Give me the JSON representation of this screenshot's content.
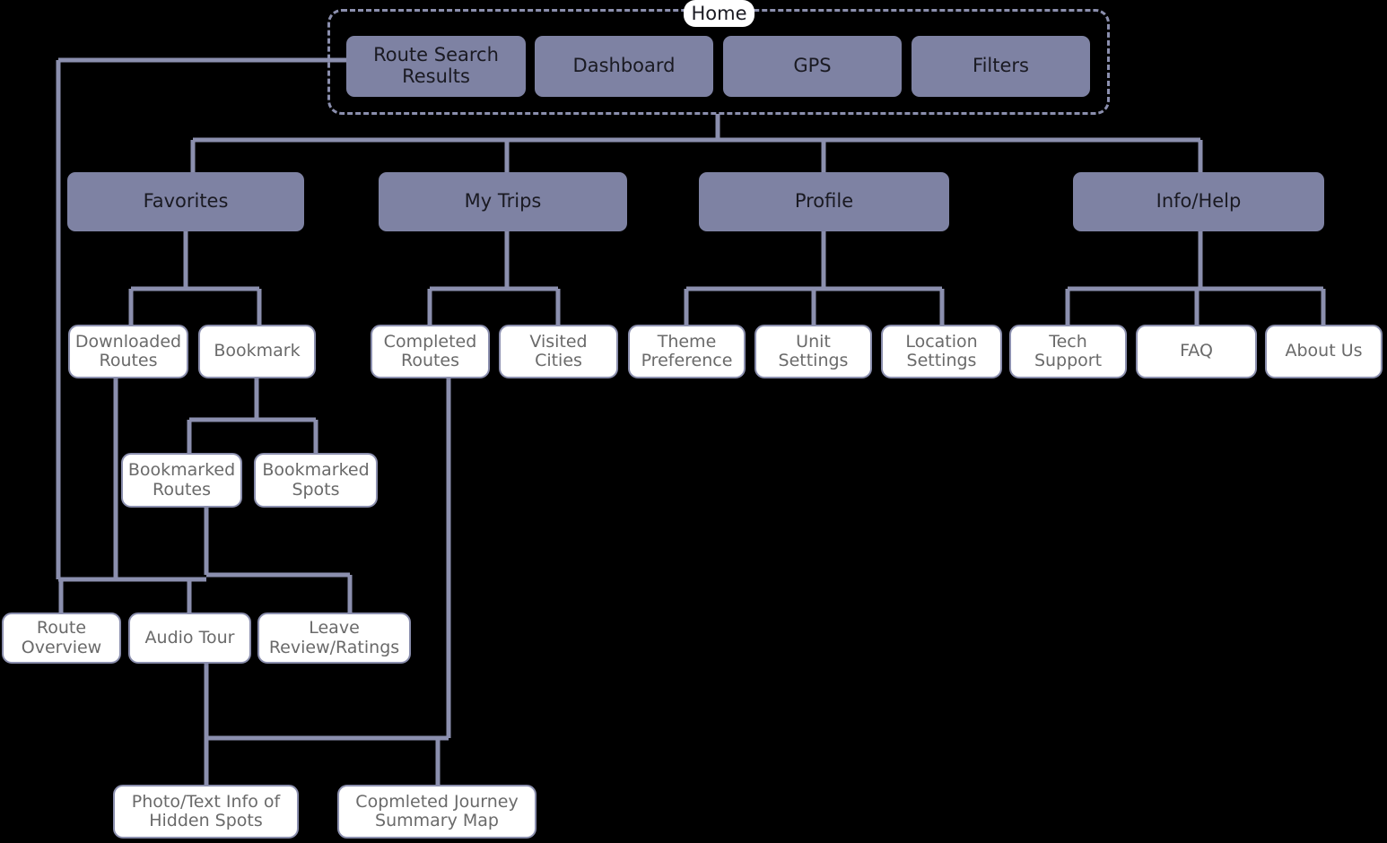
{
  "diagram": {
    "title": "Home",
    "type": "sitemap",
    "colors": {
      "background": "#000000",
      "branch_fill": "#7e82a3",
      "leaf_fill": "#ffffff",
      "stroke": "#8b8fae",
      "branch_text": "#1a1a22",
      "leaf_text": "#6a6a6a"
    }
  },
  "group": {
    "label": "Home",
    "items": [
      {
        "label": "Route Search Results"
      },
      {
        "label": "Dashboard"
      },
      {
        "label": "GPS"
      },
      {
        "label": "Filters"
      }
    ]
  },
  "branches": [
    {
      "label": "Favorites"
    },
    {
      "label": "My Trips"
    },
    {
      "label": "Profile"
    },
    {
      "label": "Info/Help"
    }
  ],
  "leaves": {
    "downloaded_routes": "Downloaded Routes",
    "bookmark": "Bookmark",
    "completed_routes": "Completed Routes",
    "visited_cities": "Visited Cities",
    "theme_preference": "Theme Preference",
    "unit_settings": "Unit Settings",
    "location_settings": "Location Settings",
    "tech_support": "Tech Support",
    "faq": "FAQ",
    "about_us": "About Us",
    "bookmarked_routes": "Bookmarked Routes",
    "bookmarked_spots": "Bookmarked Spots",
    "route_overview": "Route Overview",
    "audio_tour": "Audio Tour",
    "leave_review_ratings": "Leave Review/Ratings",
    "photo_text_info": "Photo/Text Info of Hidden Spots",
    "completed_journey_map": "Copmleted Journey Summary Map"
  }
}
